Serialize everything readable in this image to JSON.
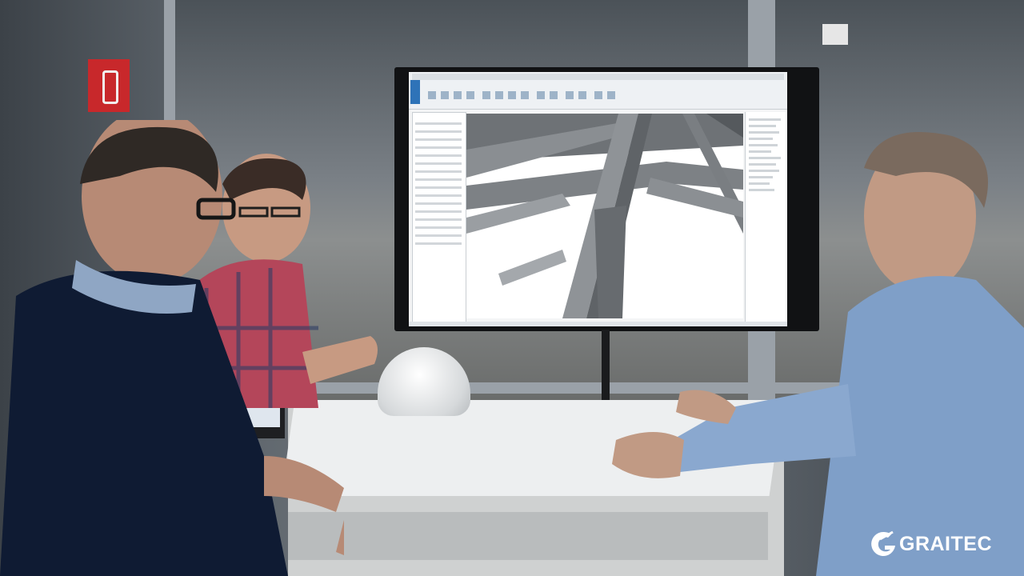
{
  "logo": {
    "text": "GRAITEC",
    "color": "#ffffff"
  },
  "colors": {
    "exit_sign": "#c8282b",
    "revit_accent": "#2e73b8",
    "shirt_blue": "#7f9fc8",
    "plaid_red": "#b4465a"
  }
}
